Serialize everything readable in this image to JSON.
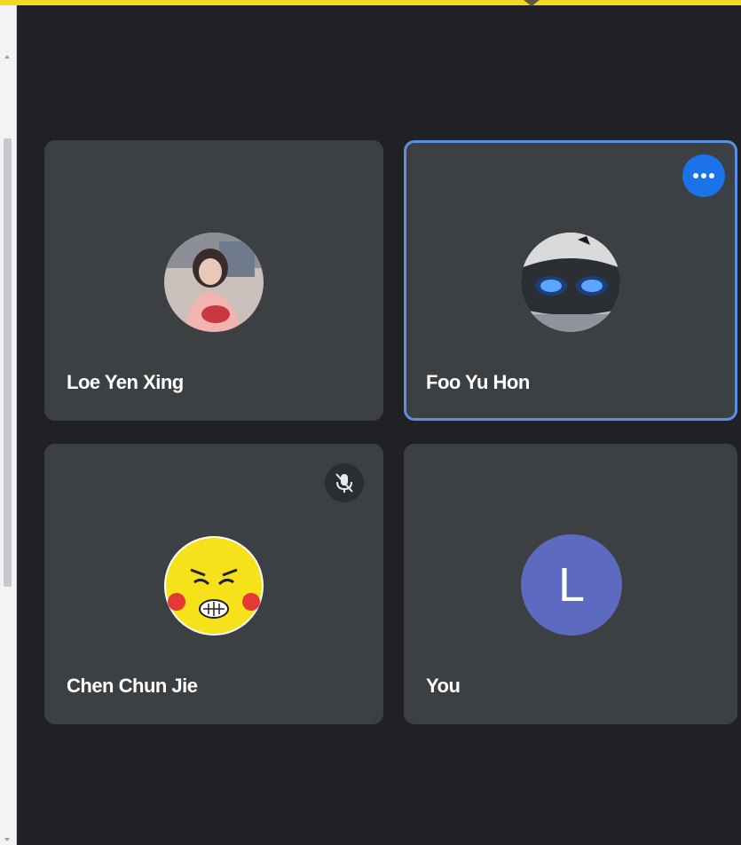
{
  "participants": [
    {
      "name": "Loe Yen Xing",
      "avatar_icon": "participant-photo"
    },
    {
      "name": "Foo Yu Hon",
      "avatar_icon": "participant-photo",
      "active_speaker": true
    },
    {
      "name": "Chen Chun Jie",
      "avatar_icon": "participant-photo",
      "muted": true
    },
    {
      "name": "You",
      "avatar_letter": "L",
      "avatar_color": "#5c6bc0"
    }
  ],
  "colors": {
    "background": "#202124",
    "tile": "#3c4043",
    "accent": "#1a73e8",
    "active_border": "#5b8ee6",
    "banner": "#f2d81f"
  },
  "icons": {
    "more_options": "more-options-icon",
    "mic_off": "mic-off-icon"
  }
}
